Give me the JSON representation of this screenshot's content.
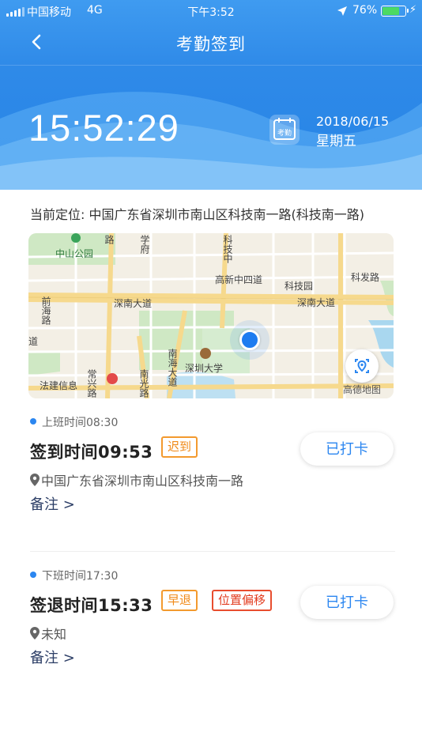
{
  "status_bar": {
    "carrier": "中国移动",
    "network": "4G",
    "time": "下午3:52",
    "battery_pct": "76%",
    "battery_level": 0.76,
    "battery_color": "#4cd964"
  },
  "nav": {
    "title": "考勤签到",
    "back_icon": "chevron-left-icon"
  },
  "banner": {
    "clock": "15:52:29",
    "calendar_icon_label": "考勤",
    "date": "2018/06/15",
    "weekday": "星期五",
    "accent": "#2f8ae8"
  },
  "location": {
    "text": "当前定位: 中国广东省深圳市南山区科技南一路(科技南一路)"
  },
  "map": {
    "labels": {
      "zhongshan_park": "中山公园",
      "gaoxin_zhongsi": "高新中四道",
      "kejiyuan": "科技园",
      "kefa_road": "科发路",
      "shennan_left": "深南大道",
      "shennan_right": "深南大道",
      "shenzhen_univ": "深圳大学",
      "nanhai_road": "南海大道",
      "nanguang_road": "南光路",
      "qianhai_road": "前海路",
      "keji_zhong": "科技中",
      "fazhan": "法建信息",
      "changxing": "常兴路",
      "dao_left": "道",
      "xuefu": "学府",
      "road_kj": "路",
      "amap": "高德地图"
    },
    "locate_icon": "locate-icon"
  },
  "records": [
    {
      "shift": "上班时间08:30",
      "title": "签到时间09:53",
      "tags": [
        "迟到"
      ],
      "address": "中国广东省深圳市南山区科技南一路",
      "note": "备注 >",
      "button": "已打卡"
    },
    {
      "shift": "下班时间17:30",
      "title": "签退时间15:33",
      "tags": [
        "早退",
        "位置偏移"
      ],
      "address": "未知",
      "note": "备注 >",
      "button": "已打卡"
    }
  ]
}
